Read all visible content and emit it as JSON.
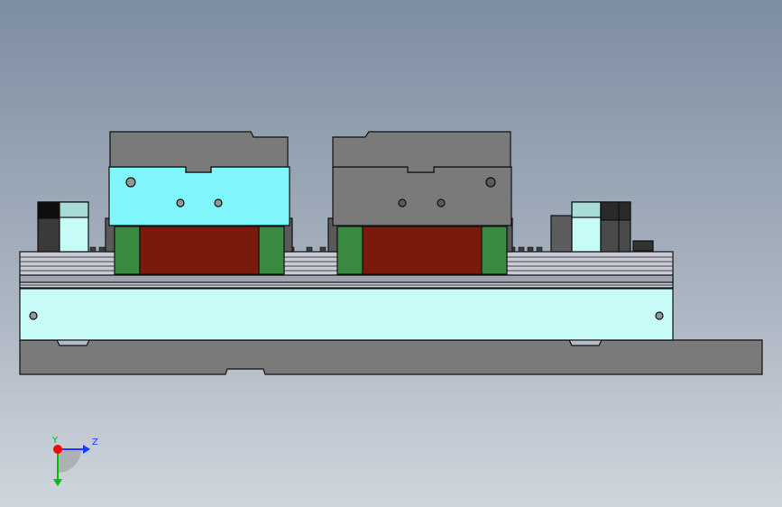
{
  "triad": {
    "labels": {
      "y": "Y",
      "z": "Z"
    },
    "colors": {
      "y": "#00c000",
      "z": "#1a3cff",
      "x": "#ff0000"
    }
  },
  "colors": {
    "background_top": "#7d8ea1",
    "background_bottom": "#cfd5dc",
    "steel": "#7a7a7a",
    "steel_dark": "#5a5a5a",
    "jaw_cyan": "#7ff6fb",
    "plate_cyan": "#c6fbf7",
    "rail_light": "#c8cbd6",
    "pad_green": "#3a8a42",
    "pad_red": "#7a1a0c",
    "black_block": "#222222",
    "outline": "#111111"
  }
}
